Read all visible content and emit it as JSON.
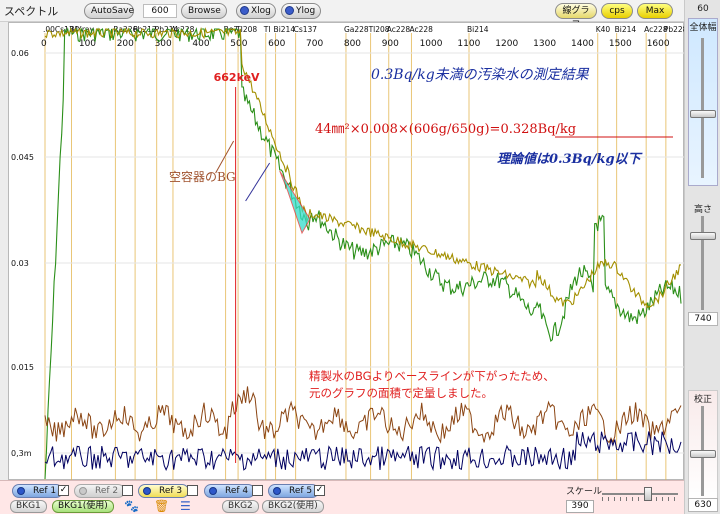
{
  "titlebar": {
    "title": "スペクトル",
    "autosave_label": "AutoSave",
    "channel_value": "600",
    "browse_label": "Browse",
    "xlog_label": "Xlog",
    "ylog_label": "Ylog",
    "linegraph_label": "線グラフ",
    "cps_label": "cps",
    "max_label": "Max"
  },
  "right_panel": {
    "top_value": "60",
    "full_width_label": "全体幅",
    "height_label": "高さ",
    "height_value": "740",
    "calibration_label": "校正",
    "bottom_value": "630"
  },
  "bottom_bar": {
    "refs": [
      {
        "label": "Ref 1",
        "checked": "✓",
        "style": "on"
      },
      {
        "label": "Ref 2",
        "checked": "",
        "style": "off"
      },
      {
        "label": "Ref 3",
        "checked": "",
        "style": "yellow"
      },
      {
        "label": "Ref 4",
        "checked": "",
        "style": "on"
      },
      {
        "label": "Ref 5",
        "checked": "✓",
        "style": "on"
      }
    ],
    "bkg1_label": "BKG1",
    "bkg1_use_label": "BKG1(使用)",
    "bkg2_label": "BKG2",
    "bkg2_use_label": "BKG2(使用)",
    "scale_label": "スケール",
    "scale_value": "390"
  },
  "chart_data": {
    "type": "line",
    "x_ticks": [
      "0",
      "100",
      "200",
      "300",
      "400",
      "500",
      "600",
      "700",
      "800",
      "900",
      "1000",
      "1100",
      "1200",
      "1300",
      "1400",
      "1500",
      "1600"
    ],
    "y_ticks": [
      "0.06",
      "0.045",
      "0.03",
      "0.015",
      "0,3m"
    ],
    "peak_labels": [
      {
        "text": ".00Cs134",
        "ch": 0
      },
      {
        "text": "BiXray",
        "ch": 70
      },
      {
        "text": "Ra226",
        "ch": 186
      },
      {
        "text": "Pb212",
        "ch": 238
      },
      {
        "text": "Pb214",
        "ch": 295
      },
      {
        "text": "Ac228",
        "ch": 338
      },
      {
        "text": "Be7",
        "ch": 477
      },
      {
        "text": "TI208",
        "ch": 510
      },
      {
        "text": "TI",
        "ch": 583
      },
      {
        "text": "Bi214",
        "ch": 609
      },
      {
        "text": "Cs137",
        "ch": 662
      },
      {
        "text": "Ga228",
        "ch": 795
      },
      {
        "text": "Ac228",
        "ch": 908
      },
      {
        "text": "Tl208",
        "ch": 860
      },
      {
        "text": "Ac228",
        "ch": 968
      },
      {
        "text": "Bi214",
        "ch": 1120
      },
      {
        "text": "K40",
        "ch": 1460
      },
      {
        "text": "Bi214",
        "ch": 1510
      },
      {
        "text": "Ac228",
        "ch": 1588
      },
      {
        "text": "Pb228",
        "ch": 1640
      }
    ],
    "energy_marker": "662keV",
    "annotations": {
      "main_result": "0.3Bq/kg未満の汚染水の測定結果",
      "formula": "44㎜²×0.008×(606g/650g)=0.328Bq/kg",
      "theory": "理論値は0.3Bq/kg以下",
      "empty_bg": "空容器のBG",
      "note_line1": "精製水のBGよりベースラインが下がったため、",
      "note_line2": "元のグラフの面積で定量しました。"
    },
    "series": [
      {
        "color": "#2b8f19"
      },
      {
        "color": "#a38f00"
      },
      {
        "color": "#8b4513"
      },
      {
        "color": "#000060"
      }
    ]
  }
}
